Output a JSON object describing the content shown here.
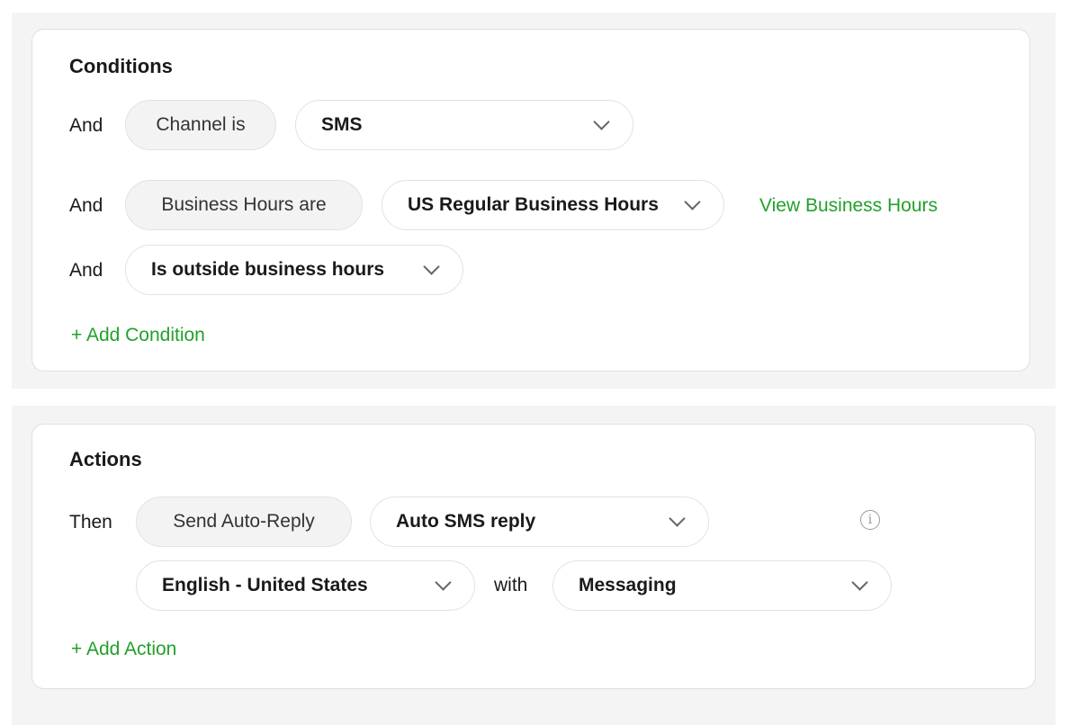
{
  "conditions": {
    "title": "Conditions",
    "rows": [
      {
        "connector": "And",
        "field": "Channel is",
        "value": "SMS"
      },
      {
        "connector": "And",
        "field": "Business Hours are",
        "value": "US Regular Business Hours",
        "link": "View Business Hours"
      },
      {
        "connector": "And",
        "value": "Is outside business hours"
      }
    ],
    "add_label": "+ Add Condition"
  },
  "actions": {
    "title": "Actions",
    "connector": "Then",
    "action": "Send Auto-Reply",
    "reply": "Auto SMS reply",
    "language": "English - United States",
    "with_label": "with",
    "channel": "Messaging",
    "add_label": "+ Add Action",
    "info_icon": "info-icon"
  },
  "colors": {
    "accent": "#22a02a"
  }
}
